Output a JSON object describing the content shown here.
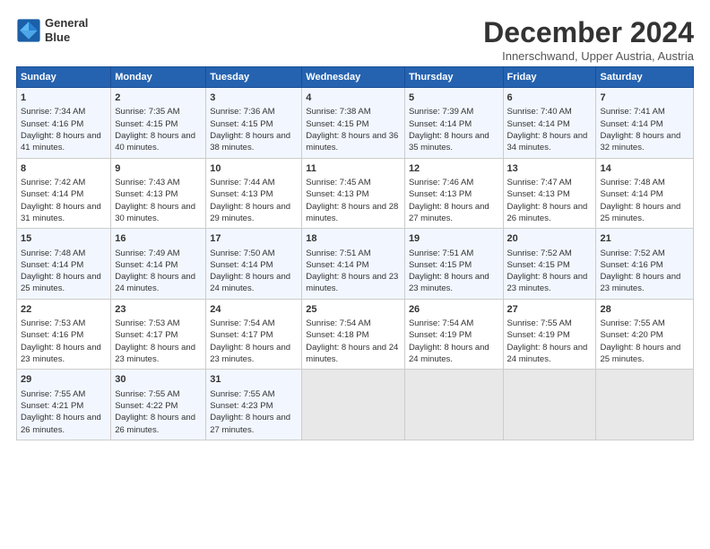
{
  "logo": {
    "line1": "General",
    "line2": "Blue"
  },
  "title": "December 2024",
  "subtitle": "Innerschwand, Upper Austria, Austria",
  "headers": [
    "Sunday",
    "Monday",
    "Tuesday",
    "Wednesday",
    "Thursday",
    "Friday",
    "Saturday"
  ],
  "weeks": [
    [
      {
        "day": "1",
        "sunrise": "7:34 AM",
        "sunset": "4:16 PM",
        "daylight": "8 hours and 41 minutes."
      },
      {
        "day": "2",
        "sunrise": "7:35 AM",
        "sunset": "4:15 PM",
        "daylight": "8 hours and 40 minutes."
      },
      {
        "day": "3",
        "sunrise": "7:36 AM",
        "sunset": "4:15 PM",
        "daylight": "8 hours and 38 minutes."
      },
      {
        "day": "4",
        "sunrise": "7:38 AM",
        "sunset": "4:15 PM",
        "daylight": "8 hours and 36 minutes."
      },
      {
        "day": "5",
        "sunrise": "7:39 AM",
        "sunset": "4:14 PM",
        "daylight": "8 hours and 35 minutes."
      },
      {
        "day": "6",
        "sunrise": "7:40 AM",
        "sunset": "4:14 PM",
        "daylight": "8 hours and 34 minutes."
      },
      {
        "day": "7",
        "sunrise": "7:41 AM",
        "sunset": "4:14 PM",
        "daylight": "8 hours and 32 minutes."
      }
    ],
    [
      {
        "day": "8",
        "sunrise": "7:42 AM",
        "sunset": "4:14 PM",
        "daylight": "8 hours and 31 minutes."
      },
      {
        "day": "9",
        "sunrise": "7:43 AM",
        "sunset": "4:13 PM",
        "daylight": "8 hours and 30 minutes."
      },
      {
        "day": "10",
        "sunrise": "7:44 AM",
        "sunset": "4:13 PM",
        "daylight": "8 hours and 29 minutes."
      },
      {
        "day": "11",
        "sunrise": "7:45 AM",
        "sunset": "4:13 PM",
        "daylight": "8 hours and 28 minutes."
      },
      {
        "day": "12",
        "sunrise": "7:46 AM",
        "sunset": "4:13 PM",
        "daylight": "8 hours and 27 minutes."
      },
      {
        "day": "13",
        "sunrise": "7:47 AM",
        "sunset": "4:13 PM",
        "daylight": "8 hours and 26 minutes."
      },
      {
        "day": "14",
        "sunrise": "7:48 AM",
        "sunset": "4:14 PM",
        "daylight": "8 hours and 25 minutes."
      }
    ],
    [
      {
        "day": "15",
        "sunrise": "7:48 AM",
        "sunset": "4:14 PM",
        "daylight": "8 hours and 25 minutes."
      },
      {
        "day": "16",
        "sunrise": "7:49 AM",
        "sunset": "4:14 PM",
        "daylight": "8 hours and 24 minutes."
      },
      {
        "day": "17",
        "sunrise": "7:50 AM",
        "sunset": "4:14 PM",
        "daylight": "8 hours and 24 minutes."
      },
      {
        "day": "18",
        "sunrise": "7:51 AM",
        "sunset": "4:14 PM",
        "daylight": "8 hours and 23 minutes."
      },
      {
        "day": "19",
        "sunrise": "7:51 AM",
        "sunset": "4:15 PM",
        "daylight": "8 hours and 23 minutes."
      },
      {
        "day": "20",
        "sunrise": "7:52 AM",
        "sunset": "4:15 PM",
        "daylight": "8 hours and 23 minutes."
      },
      {
        "day": "21",
        "sunrise": "7:52 AM",
        "sunset": "4:16 PM",
        "daylight": "8 hours and 23 minutes."
      }
    ],
    [
      {
        "day": "22",
        "sunrise": "7:53 AM",
        "sunset": "4:16 PM",
        "daylight": "8 hours and 23 minutes."
      },
      {
        "day": "23",
        "sunrise": "7:53 AM",
        "sunset": "4:17 PM",
        "daylight": "8 hours and 23 minutes."
      },
      {
        "day": "24",
        "sunrise": "7:54 AM",
        "sunset": "4:17 PM",
        "daylight": "8 hours and 23 minutes."
      },
      {
        "day": "25",
        "sunrise": "7:54 AM",
        "sunset": "4:18 PM",
        "daylight": "8 hours and 24 minutes."
      },
      {
        "day": "26",
        "sunrise": "7:54 AM",
        "sunset": "4:19 PM",
        "daylight": "8 hours and 24 minutes."
      },
      {
        "day": "27",
        "sunrise": "7:55 AM",
        "sunset": "4:19 PM",
        "daylight": "8 hours and 24 minutes."
      },
      {
        "day": "28",
        "sunrise": "7:55 AM",
        "sunset": "4:20 PM",
        "daylight": "8 hours and 25 minutes."
      }
    ],
    [
      {
        "day": "29",
        "sunrise": "7:55 AM",
        "sunset": "4:21 PM",
        "daylight": "8 hours and 26 minutes."
      },
      {
        "day": "30",
        "sunrise": "7:55 AM",
        "sunset": "4:22 PM",
        "daylight": "8 hours and 26 minutes."
      },
      {
        "day": "31",
        "sunrise": "7:55 AM",
        "sunset": "4:23 PM",
        "daylight": "8 hours and 27 minutes."
      },
      null,
      null,
      null,
      null
    ]
  ]
}
